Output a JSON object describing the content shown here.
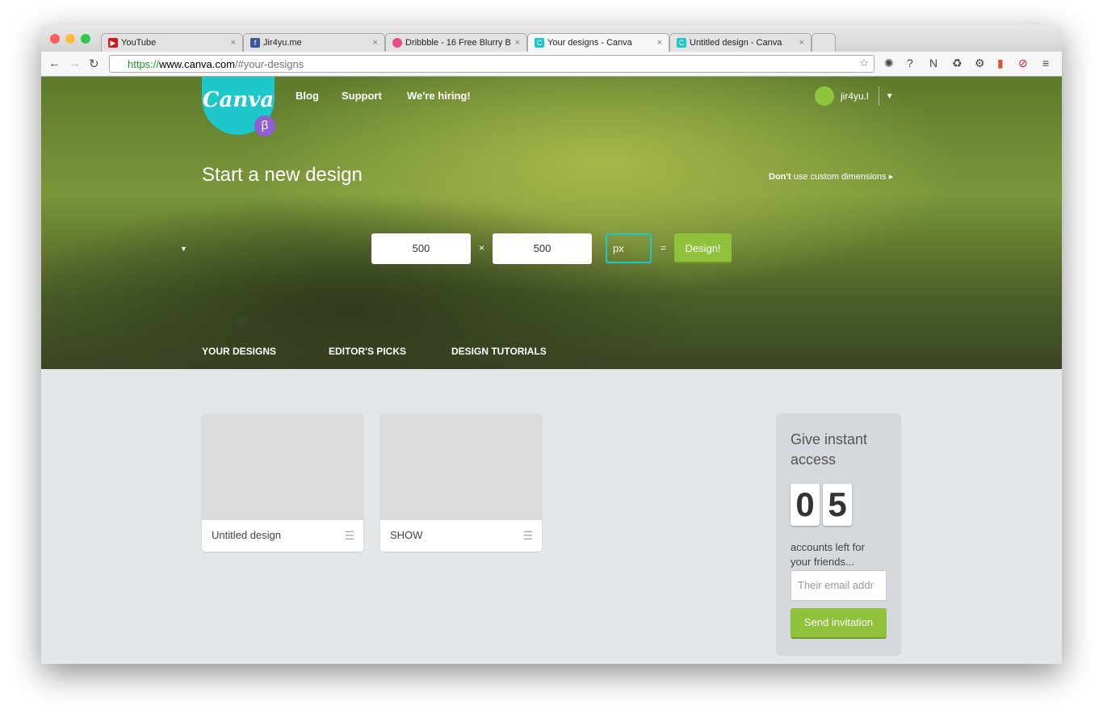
{
  "browser": {
    "tabs": [
      {
        "title": "YouTube",
        "favicon": "youtube-icon",
        "color": "#cc181e"
      },
      {
        "title": "Jir4yu.me",
        "favicon": "facebook-icon",
        "color": "#3b5998"
      },
      {
        "title": "Dribbble - 16 Free Blurry B",
        "favicon": "dribbble-icon",
        "color": "#ea4c89"
      },
      {
        "title": "Your designs - Canva",
        "favicon": "canva-icon",
        "color": "#1ec7c9",
        "active": true
      },
      {
        "title": "Untitled design - Canva",
        "favicon": "canva-icon",
        "color": "#1ec7c9"
      }
    ],
    "url_scheme": "https://",
    "url_host": "www.canva.com",
    "url_path": "/#your-designs"
  },
  "header": {
    "logo": "Canva",
    "beta": "β",
    "links": [
      "Blog",
      "Support",
      "We're hiring!"
    ],
    "user": "jir4yu.l"
  },
  "hero": {
    "title": "Start a new design",
    "custom_bold": "Don't",
    "custom_rest": " use custom dimensions ▸",
    "width": "500",
    "times": "×",
    "height": "500",
    "unit": "px",
    "equals": "=",
    "design_button": "Design!"
  },
  "tabs": [
    "YOUR DESIGNS",
    "EDITOR'S PICKS",
    "DESIGN TUTORIALS"
  ],
  "designs": [
    {
      "name": "Untitled design"
    },
    {
      "name": "SHOW"
    }
  ],
  "invite": {
    "title": "Give instant access",
    "digits": [
      "0",
      "5"
    ],
    "text": "accounts left for your friends...",
    "placeholder": "Their email addr",
    "button": "Send invitation"
  },
  "colors": {
    "accent": "#1ec7c9",
    "green": "#8fc23a",
    "beta": "#8f5fd3"
  }
}
